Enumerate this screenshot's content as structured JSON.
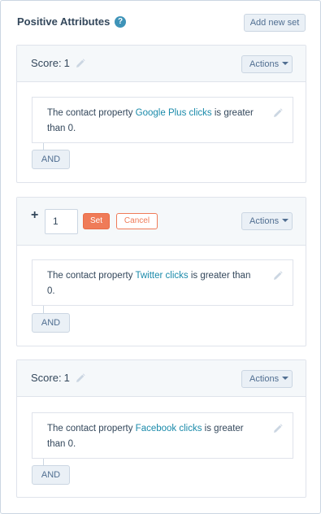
{
  "header": {
    "title": "Positive Attributes",
    "help_glyph": "?",
    "add_new_label": "Add new set"
  },
  "sets": [
    {
      "mode": "view",
      "score_label": "Score:",
      "score_value": "1",
      "actions_label": "Actions",
      "rule": {
        "prefix": "The contact property ",
        "property": "Google Plus clicks",
        "middle": " is greater than ",
        "value": "0",
        "suffix": "."
      },
      "and_label": "AND"
    },
    {
      "mode": "edit",
      "plus_glyph": "+",
      "input_value": "1",
      "set_label": "Set",
      "cancel_label": "Cancel",
      "actions_label": "Actions",
      "rule": {
        "prefix": "The contact property ",
        "property": "Twitter clicks",
        "middle": " is greater than ",
        "value": "0",
        "suffix": "."
      },
      "and_label": "AND"
    },
    {
      "mode": "view",
      "score_label": "Score:",
      "score_value": "1",
      "actions_label": "Actions",
      "rule": {
        "prefix": "The contact property ",
        "property": "Facebook clicks",
        "middle": " is greater than ",
        "value": "0",
        "suffix": "."
      },
      "and_label": "AND"
    }
  ],
  "icons": {
    "pencil": "pencil-icon",
    "help": "help-icon",
    "caret": "caret-down-icon"
  },
  "colors": {
    "link": "#1a8aaa",
    "accent": "#ef7b58",
    "help": "#3e93b8"
  }
}
